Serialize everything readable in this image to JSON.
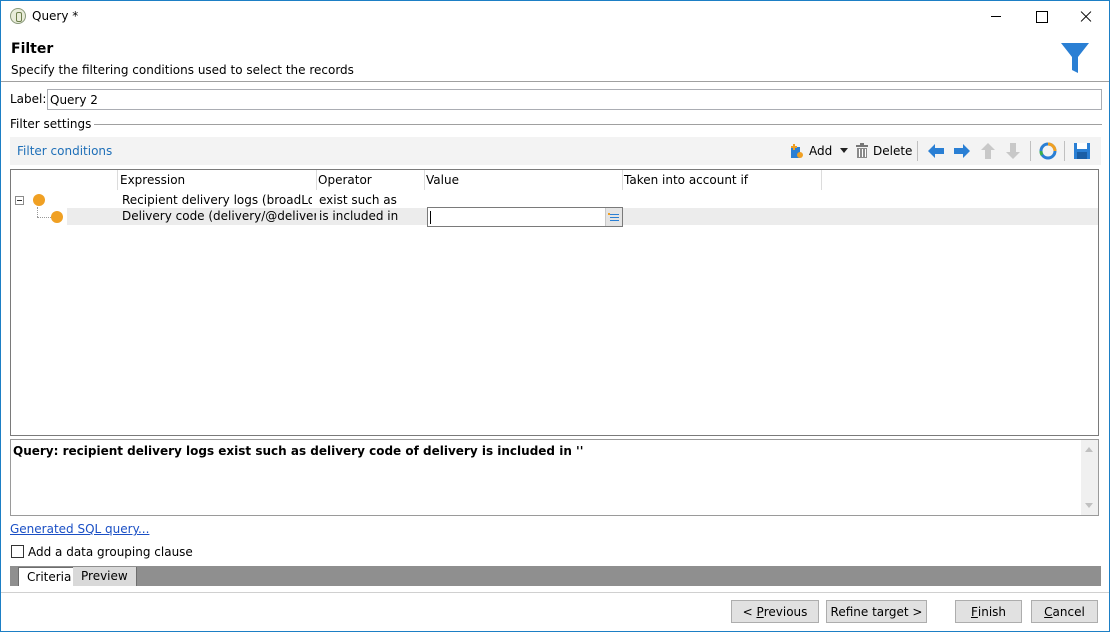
{
  "window": {
    "title": "Query *"
  },
  "header": {
    "title": "Filter",
    "subtitle": "Specify the filtering conditions used to select the records"
  },
  "label_row": {
    "label": "Label:",
    "value": "Query 2"
  },
  "group_title": "Filter settings",
  "toolbar": {
    "title": "Filter conditions",
    "add_label": "Add",
    "delete_label": "Delete"
  },
  "grid": {
    "columns": [
      "Expression",
      "Operator",
      "Value",
      "Taken into account if"
    ],
    "rows": [
      {
        "expression": "Recipient delivery logs (broadLog)",
        "operator": "exist such as",
        "value": "",
        "condition": ""
      },
      {
        "expression": "Delivery code (delivery/@deliveryCo...",
        "operator": "is included in",
        "value": "",
        "condition": ""
      }
    ]
  },
  "query_text": "Query: recipient delivery logs exist such as delivery code of delivery is included in ''",
  "sql_link": "Generated SQL query...",
  "grouping_checkbox": {
    "label": "Add a data grouping clause",
    "checked": false
  },
  "tabs": [
    {
      "label": "Criteria",
      "active": true
    },
    {
      "label": "Preview",
      "active": false
    }
  ],
  "buttons": {
    "previous_prefix": "< ",
    "previous_u": "P",
    "previous_rest": "revious",
    "refine": "Refine target >",
    "finish_u": "F",
    "finish_rest": "inish",
    "cancel_u": "C",
    "cancel_rest": "ancel"
  },
  "colors": {
    "accent_blue": "#1e6fb8",
    "icon_blue": "#2a7fd4",
    "dot_orange": "#f0a023"
  }
}
